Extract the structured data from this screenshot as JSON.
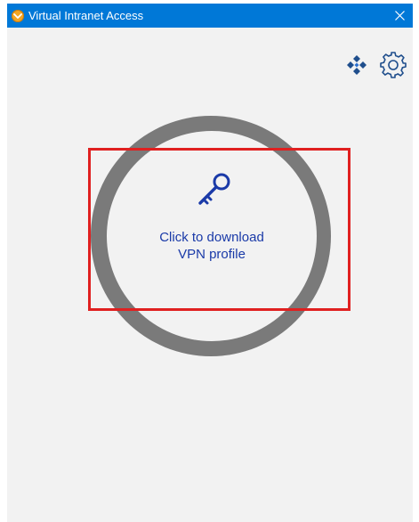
{
  "window": {
    "title": "Virtual Intranet Access",
    "close_glyph": "×",
    "title_color": "#0078d7"
  },
  "toolbar": {
    "network_icon": "network-icon",
    "settings_icon": "gear-icon"
  },
  "main": {
    "action_icon": "key-icon",
    "action_line1": "Click to download",
    "action_line2": "VPN profile",
    "text_color": "#1a3aa8",
    "highlight_color": "#e02020"
  }
}
